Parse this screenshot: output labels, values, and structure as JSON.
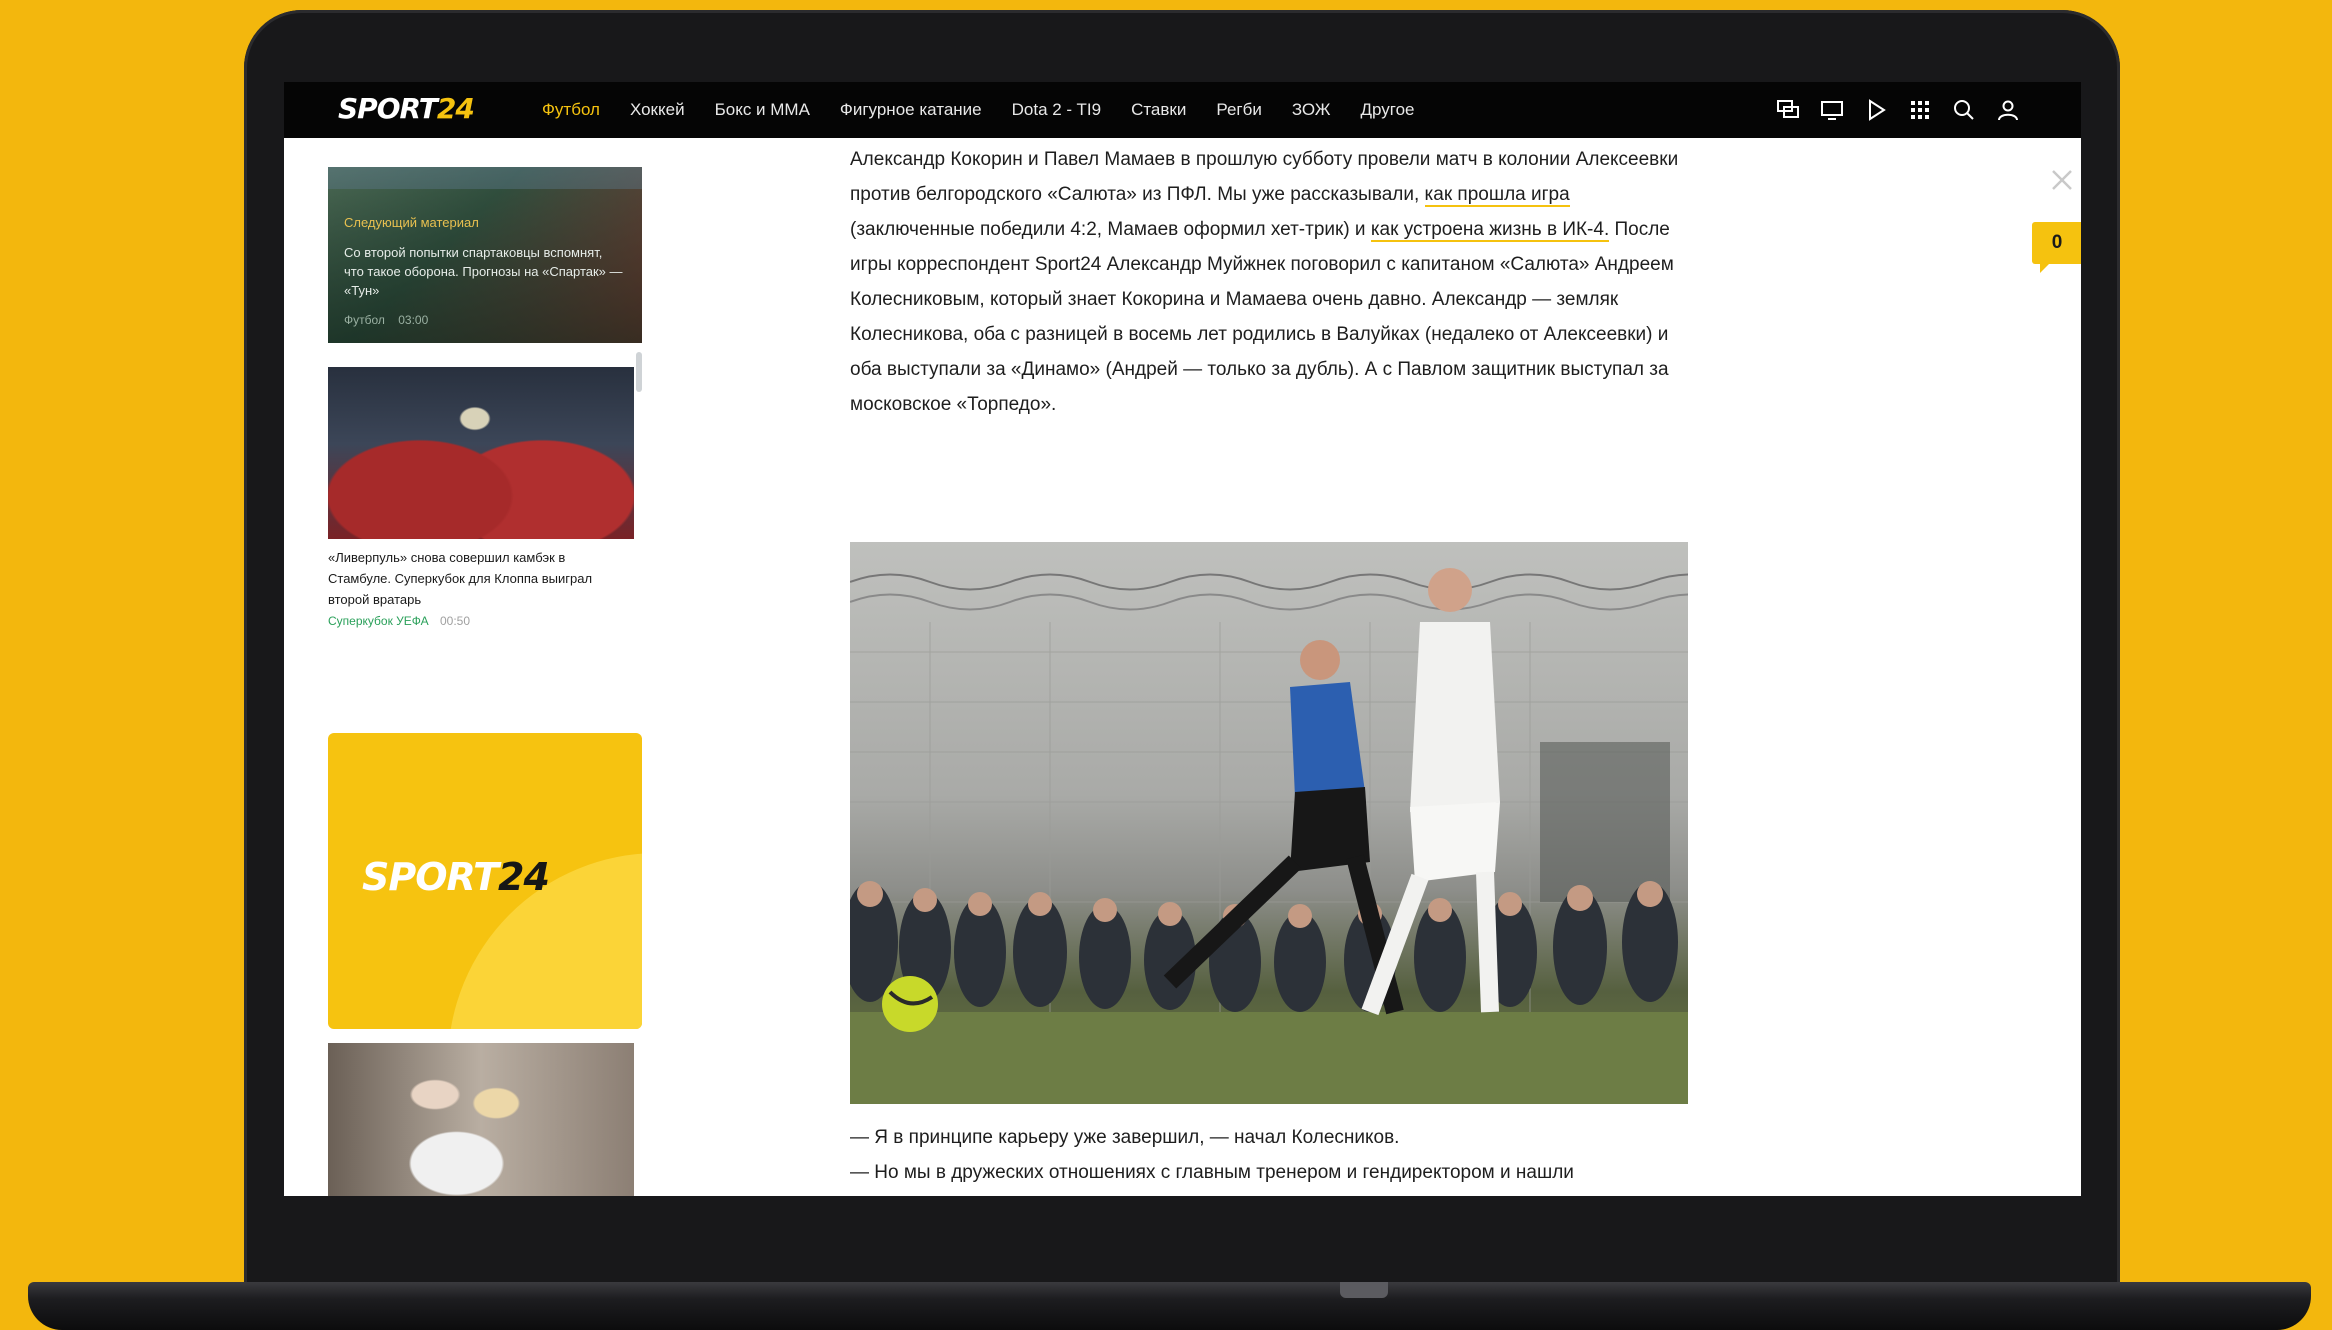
{
  "nav": {
    "logo_text": "SPORT",
    "logo_num": "24",
    "links": [
      "Футбол",
      "Хоккей",
      "Бокс и ММА",
      "Фигурное катание",
      "Dota 2 - TI9",
      "Ставки",
      "Регби",
      "ЗОЖ",
      "Другое"
    ],
    "active_link": "Футбол",
    "icons": [
      "multiscreen-icon",
      "tv-icon",
      "play-icon",
      "apps-grid-icon",
      "search-icon",
      "user-icon"
    ]
  },
  "sidebar": {
    "next_card": {
      "label": "Следующий материал",
      "title": "Со второй попытки спартаковцы вспомнят, что такое оборона. Прогнозы на «Спартак» — «Тун»",
      "meta_tag": "Футбол",
      "meta_time": "03:00"
    },
    "liverpool": {
      "title": "«Ливерпуль» снова совершил камбэк в Стамбуле. Суперкубок для Клоппа выиграл второй вратарь",
      "tag": "Суперкубок УЕФА",
      "time": "00:50"
    },
    "promo": {
      "logo_text": "SPORT",
      "logo_num": "24"
    }
  },
  "article": {
    "p1_a": "Александр Кокорин и Павел Мамаев в прошлую субботу провели матч в колонии Алексеевки против белгородского «Салюта» из ПФЛ. Мы уже рассказывали, ",
    "link1": "как прошла игра",
    "p1_b": " (заключенные победили 4:2, Мамаев оформил хет-трик) и ",
    "link2": "как устроена жизнь в ИК-4.",
    "p1_c": " После игры корреспондент Sport24 Александр Муйжнек поговорил с капитаном «Салюта» Андреем Колесниковым, который знает Кокорина и Мамаева очень давно. Александр — земляк Колесникова, оба с разницей в восемь лет родились в Валуйках (недалеко от Алексеевки) и оба выступали за «Динамо» (Андрей — только за дубль). А с Павлом защитник выступал за московское «Торпедо».",
    "quote1": "— Я в принципе карьеру уже завершил, — начал Колесников.",
    "quote2": "— Но мы в дружеских отношениях с главным тренером и гендиректором и нашли"
  },
  "comments": {
    "count": "0"
  },
  "colors": {
    "accent": "#f5c20f",
    "background": "#f3b70d",
    "nav_bg": "#050505",
    "tag_green": "#2aa05a"
  }
}
